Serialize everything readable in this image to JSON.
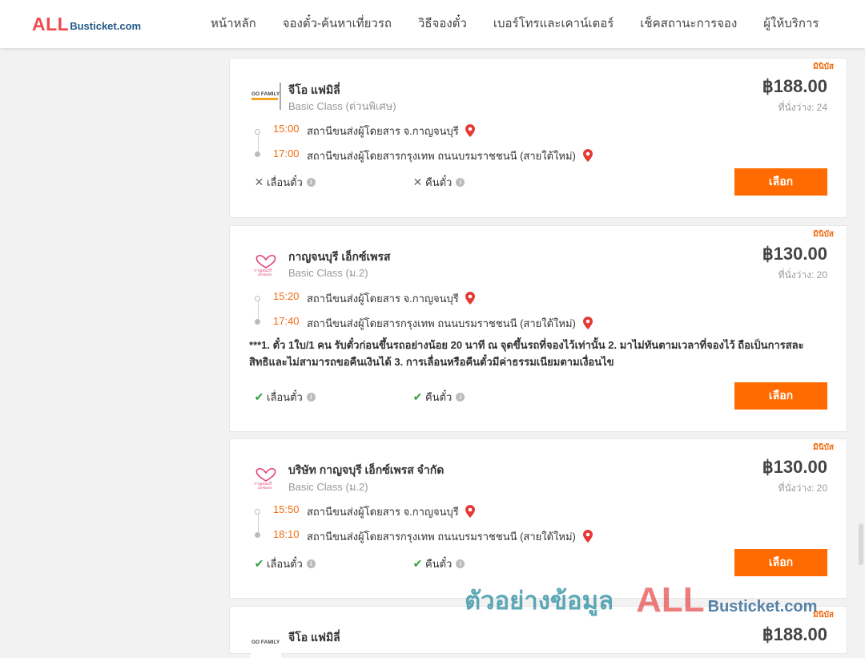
{
  "header": {
    "logo_all": "ALL",
    "logo_rest": "Busticket.com",
    "nav": [
      "หน้าหลัก",
      "จองตั๋ว-ค้นหาเที่ยวรถ",
      "วิธีจองตั๋ว",
      "เบอร์โทรและเคาน์เตอร์",
      "เช็คสถานะการจอง",
      "ผู้ให้บริการ"
    ]
  },
  "cards": [
    {
      "badge": "มินิบัส",
      "operator": "จีโอ แฟมิลี่",
      "logo_text": "GO FAMILY",
      "class": "Basic Class (ด่วนพิเศษ)",
      "price": "฿188.00",
      "seats": "ที่นั่งว่าง: 24",
      "depart_time": "15:00",
      "depart_station": "สถานีขนส่งผู้โดยสาร จ.กาญจนบุรี",
      "arrive_time": "17:00",
      "arrive_station": "สถานีขนส่งผู้โดยสารกรุงเทพ ถนนบรมราชชนนี (สายใต้ใหม่)",
      "change_label": "เลื่อนตั๋ว",
      "refund_label": "คืนตั๋ว",
      "change_allowed": false,
      "refund_allowed": false,
      "button": "เลือก"
    },
    {
      "badge": "มินิบัส",
      "operator": "กาญจนบุรี เอ็กซ์เพรส",
      "logo_text": "กาญจนบุรี เอ็กซ์เพรส",
      "class": "Basic Class (ม.2)",
      "price": "฿130.00",
      "seats": "ที่นั่งว่าง: 20",
      "depart_time": "15:20",
      "depart_station": "สถานีขนส่งผู้โดยสาร จ.กาญจนบุรี",
      "arrive_time": "17:40",
      "arrive_station": "สถานีขนส่งผู้โดยสารกรุงเทพ ถนนบรมราชชนนี (สายใต้ใหม่)",
      "note": "***1. ตั๋ว 1ใบ/1 คน รับตั๋วก่อนขึ้นรถอย่างน้อย 20 นาที ณ จุดขึ้นรถที่จองไว้เท่านั้น 2. มาไม่ทันตามเวลาที่จองไว้ ถือเป็นการสละสิทธิและไม่สามารถขอคืนเงินได้ 3. การเลื่อนหรือคืนตั๋วมีค่าธรรมเนียมตามเงื่อนไข",
      "change_label": "เลื่อนตั๋ว",
      "refund_label": "คืนตั๋ว",
      "change_allowed": true,
      "refund_allowed": true,
      "button": "เลือก"
    },
    {
      "badge": "มินิบัส",
      "operator": "บริษัท กาญจบุรี เอ็กซ์เพรส จำกัด",
      "logo_text": "กาญจนบุรี เอ็กซ์เพรส",
      "class": "Basic Class (ม.2)",
      "price": "฿130.00",
      "seats": "ที่นั่งว่าง: 20",
      "depart_time": "15:50",
      "depart_station": "สถานีขนส่งผู้โดยสาร จ.กาญจนบุรี",
      "arrive_time": "18:10",
      "arrive_station": "สถานีขนส่งผู้โดยสารกรุงเทพ ถนนบรมราชชนนี (สายใต้ใหม่)",
      "change_label": "เลื่อนตั๋ว",
      "refund_label": "คืนตั๋ว",
      "change_allowed": true,
      "refund_allowed": true,
      "button": "เลือก"
    },
    {
      "badge": "มินิบัส",
      "operator": "จีโอ แฟมิลี่",
      "logo_text": "GO FAMILY",
      "price": "฿188.00"
    }
  ],
  "watermark": {
    "thai": "ตัวอย่างข้อมูล",
    "all": "ALL",
    "rest": "Busticket.com"
  },
  "colors": {
    "accent": "#ff6b00",
    "time": "#f26b0f",
    "logo_red": "#ef4a4f",
    "logo_blue": "#245a8a"
  }
}
